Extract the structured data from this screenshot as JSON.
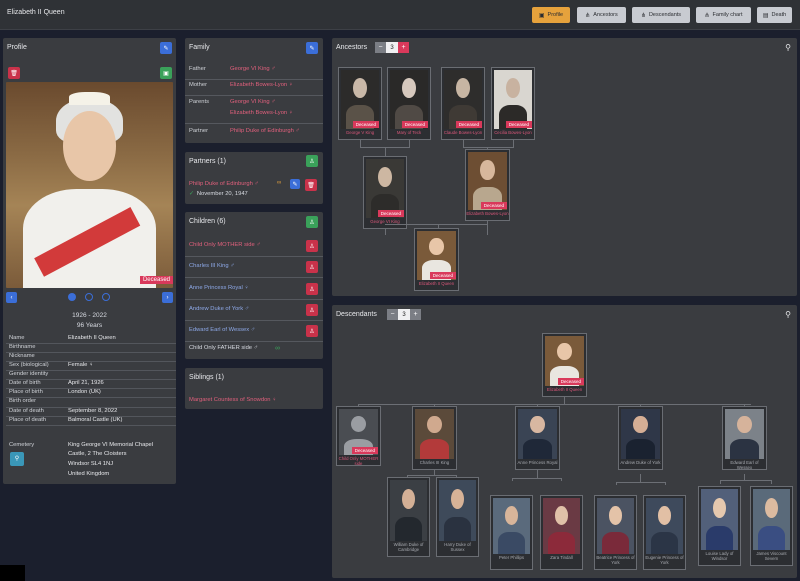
{
  "app": {
    "title": "Elizabeth II Queen"
  },
  "toolbar": {
    "profile": "Profile",
    "ancestors": "Ancestors",
    "descendants": "Descendants",
    "family_chart": "Family chart",
    "death": "Death"
  },
  "profile": {
    "title": "Profile",
    "deceased": "Deceased",
    "years": "1926 - 2022",
    "age": "96 Years",
    "fields": [
      {
        "k": "Name",
        "v": "Elizabeth II Queen"
      },
      {
        "k": "Birthname",
        "v": ""
      },
      {
        "k": "Nickname",
        "v": ""
      },
      {
        "k": "Sex (biological)",
        "v": "Female ♀"
      },
      {
        "k": "Gender identity",
        "v": ""
      },
      {
        "k": "Date of birth",
        "v": "April 21, 1926"
      },
      {
        "k": "Place of birth",
        "v": "London (UK)"
      },
      {
        "k": "Birth order",
        "v": ""
      },
      {
        "k": "Date of death",
        "v": "September 8, 2022"
      },
      {
        "k": "Place of death",
        "v": "Balmoral Castle (UK)"
      }
    ],
    "cemetery_label": "Cemetery",
    "cemetery_lines": [
      "King George VI Memorial Chapel",
      "Castle, 2 The Cloisters",
      "Windsor SL4 1NJ",
      "United Kingdom"
    ]
  },
  "family": {
    "title": "Family",
    "father_label": "Father",
    "father": "George VI King ♂",
    "mother_label": "Mother",
    "mother": "Elizabeth Bowes-Lyon ♀",
    "parents_label": "Parents",
    "parents_1": "George VI King ♂",
    "parents_2": "Elizabeth Bowes-Lyon ♀",
    "partner_label": "Partner",
    "partner": "Philip Duke of Edinburgh ♂"
  },
  "partners": {
    "title": "Partners (1)",
    "name": "Philip Duke of Edinburgh ♂",
    "date": "November 20, 1947"
  },
  "children": {
    "title": "Children (6)",
    "items": [
      {
        "label": "Child Only MOTHER side ♂"
      },
      {
        "label": "Charles III King ♂"
      },
      {
        "label": "Anne Princess Royal ♀"
      },
      {
        "label": "Andrew Duke of York ♂"
      },
      {
        "label": "Edward Earl of Wessex ♂"
      },
      {
        "label": "Child Only FATHER side ♂"
      }
    ]
  },
  "siblings": {
    "title": "Siblings (1)",
    "item": "Margaret Countess of Snowdon ♀"
  },
  "ancestors": {
    "title": "Ancestors",
    "count": "3",
    "gen1": [
      {
        "name": "George V King",
        "tag": "Deceased"
      },
      {
        "name": "Mary of Teck",
        "tag": "Deceased"
      },
      {
        "name": "Claude Bowes-Lyon",
        "tag": "Deceased"
      },
      {
        "name": "Cecilia Bowes-Lyon",
        "tag": "Deceased"
      }
    ],
    "gen2": [
      {
        "name": "George VI King",
        "tag": "Deceased"
      },
      {
        "name": "Elizabeth Bowes-Lyon",
        "tag": "Deceased"
      }
    ],
    "root": {
      "name": "Elizabeth II Queen",
      "tag": "Deceased"
    }
  },
  "descendants": {
    "title": "Descendants",
    "count": "3",
    "root": {
      "name": "Elizabeth II Queen",
      "tag": "Deceased"
    },
    "children": [
      {
        "name": "Child Only MOTHER side",
        "tag": "Deceased"
      },
      {
        "name": "Charles III King"
      },
      {
        "name": "Anne Princess Royal"
      },
      {
        "name": "Andrew Duke of York"
      },
      {
        "name": "Edward Earl of Wessex"
      }
    ],
    "grandchildren": [
      {
        "name": "William Duke of Cambridge"
      },
      {
        "name": "Harry Duke of Sussex"
      },
      {
        "name": "Peter Phillips"
      },
      {
        "name": "Zara Tindall"
      },
      {
        "name": "Beatrice Princess of York"
      },
      {
        "name": "Eugenie Princess of York"
      },
      {
        "name": "Louise Lady of Windsor"
      },
      {
        "name": "James Viscount Severn"
      }
    ]
  },
  "icons": {
    "edit": "pencil-icon",
    "delete": "trash-icon",
    "add_person": "person-add-icon",
    "remove_person": "person-remove-icon",
    "tree": "tree-icon",
    "map": "map-pin-icon"
  },
  "colors": {
    "accent": "#e6a23c",
    "deceased": "#d9395b",
    "link": "#e0607c",
    "edit": "#3b6ed8",
    "add": "#3aa15a",
    "remove": "#c9324a"
  }
}
